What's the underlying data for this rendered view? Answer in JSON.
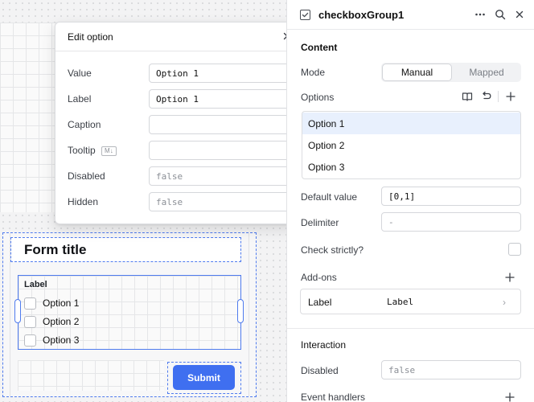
{
  "canvas": {
    "form_title": "Form title",
    "checkbox_group": {
      "label": "Label",
      "options": [
        "Option 1",
        "Option 2",
        "Option 3"
      ]
    },
    "submit_label": "Submit"
  },
  "modal": {
    "title": "Edit option",
    "close_icon": "close-icon",
    "fields": {
      "value": {
        "label": "Value",
        "value": "Option 1"
      },
      "label": {
        "label": "Label",
        "value": "Option 1"
      },
      "caption": {
        "label": "Caption",
        "value": ""
      },
      "tooltip": {
        "label": "Tooltip",
        "badge": "M↓",
        "value": ""
      },
      "disabled": {
        "label": "Disabled",
        "placeholder": "false"
      },
      "hidden": {
        "label": "Hidden",
        "placeholder": "false"
      }
    }
  },
  "inspector": {
    "component_name": "checkboxGroup1",
    "header_icons": [
      "more-icon",
      "search-icon",
      "close-icon"
    ],
    "content": {
      "title": "Content",
      "mode_label": "Mode",
      "mode_options": [
        "Manual",
        "Mapped"
      ],
      "mode_selected": "Manual",
      "options_label": "Options",
      "options_icons": [
        "book-icon",
        "undo-icon",
        "plus-icon"
      ],
      "options": [
        "Option 1",
        "Option 2",
        "Option 3"
      ],
      "selected_option": "Option 1",
      "default_value_label": "Default value",
      "default_value": "[0,1]",
      "delimiter_label": "Delimiter",
      "delimiter_placeholder": "-",
      "check_strictly_label": "Check strictly?",
      "check_strictly": false,
      "addons_label": "Add-ons",
      "addon": {
        "name": "Label",
        "value": "Label"
      }
    },
    "interaction": {
      "title": "Interaction",
      "disabled_label": "Disabled",
      "disabled_placeholder": "false",
      "event_handlers_label": "Event handlers"
    }
  },
  "colors": {
    "accent": "#3f6ff0",
    "selection_border": "#4f7bee",
    "selected_option_bg": "#e8f0fd"
  }
}
